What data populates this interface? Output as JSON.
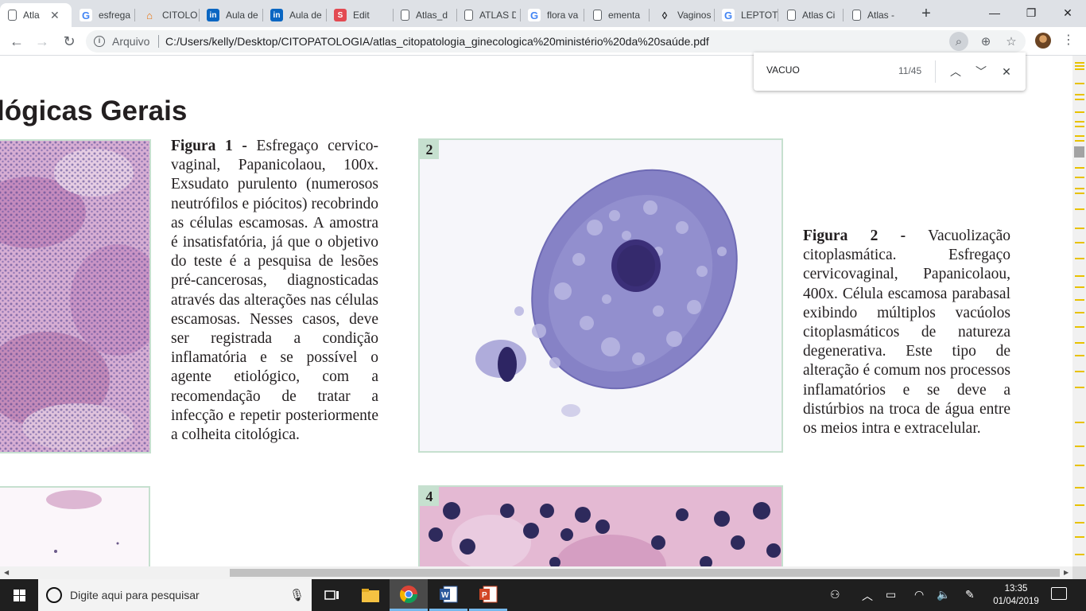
{
  "tabs": [
    {
      "label": "Atla",
      "icon": "pdf-file-icon",
      "active": true
    },
    {
      "label": "esfrega",
      "icon": "google-icon"
    },
    {
      "label": "CITOLO",
      "icon": "hat-icon"
    },
    {
      "label": "Aula de",
      "icon": "linkedin-icon"
    },
    {
      "label": "Aula de",
      "icon": "linkedin-icon"
    },
    {
      "label": "Edit",
      "icon": "s-icon"
    },
    {
      "label": "Atlas_d",
      "icon": "pdf-file-icon"
    },
    {
      "label": "ATLAS D",
      "icon": "pdf-file-icon"
    },
    {
      "label": "flora va",
      "icon": "google-icon"
    },
    {
      "label": "ementa",
      "icon": "pdf-file-icon"
    },
    {
      "label": "Vaginos",
      "icon": "drop-icon"
    },
    {
      "label": "LEPTOT",
      "icon": "google-icon"
    },
    {
      "label": "Atlas Ci",
      "icon": "pdf-file-icon"
    },
    {
      "label": "Atlas - ",
      "icon": "pdf-file-icon"
    }
  ],
  "omnibox": {
    "scheme_label": "Arquivo",
    "url": "C:/Users/kelly/Desktop/CITOPATOLOGIA/atlas_citopatologia_ginecologica%20ministério%20da%20saúde.pdf"
  },
  "find": {
    "query": "VACUO",
    "count": "11/45"
  },
  "pdf": {
    "title": "lógicas Gerais",
    "fig1": {
      "label": "Figura 1 -",
      "text": "Esfregaço cervico-vaginal, Papanicolaou, 100x. Exsudato purulento (numerosos neutrófilos e piócitos) recobrindo as células escamosas. A amostra é insatisfatória, já que o objetivo do teste é a pesquisa de lesões pré-cancerosas, diagnosticadas através das alterações nas células escamosas. Nesses casos, deve ser registrada a condição inflamatória e se possível o agente etiológico, com a recomendação de tratar a infecção e repetir posteriormente a colheita citológica."
    },
    "fig2": {
      "number": "2",
      "label": "Figura 2 -",
      "text": "Vacuolização citoplasmática. Esfregaço cervicovaginal, Papanicolaou, 400x. Célula escamosa parabasal exibindo múltiplos vacúolos citoplasmáticos de natureza degenerativa. Este tipo de alteração é comum nos processos inflamatórios e se deve a distúrbios na troca de água entre os meios intra e extracelular."
    },
    "fig4": {
      "number": "4"
    }
  },
  "taskbar": {
    "search_placeholder": "Digite aqui para pesquisar",
    "time": "13:35",
    "date": "01/04/2019"
  }
}
